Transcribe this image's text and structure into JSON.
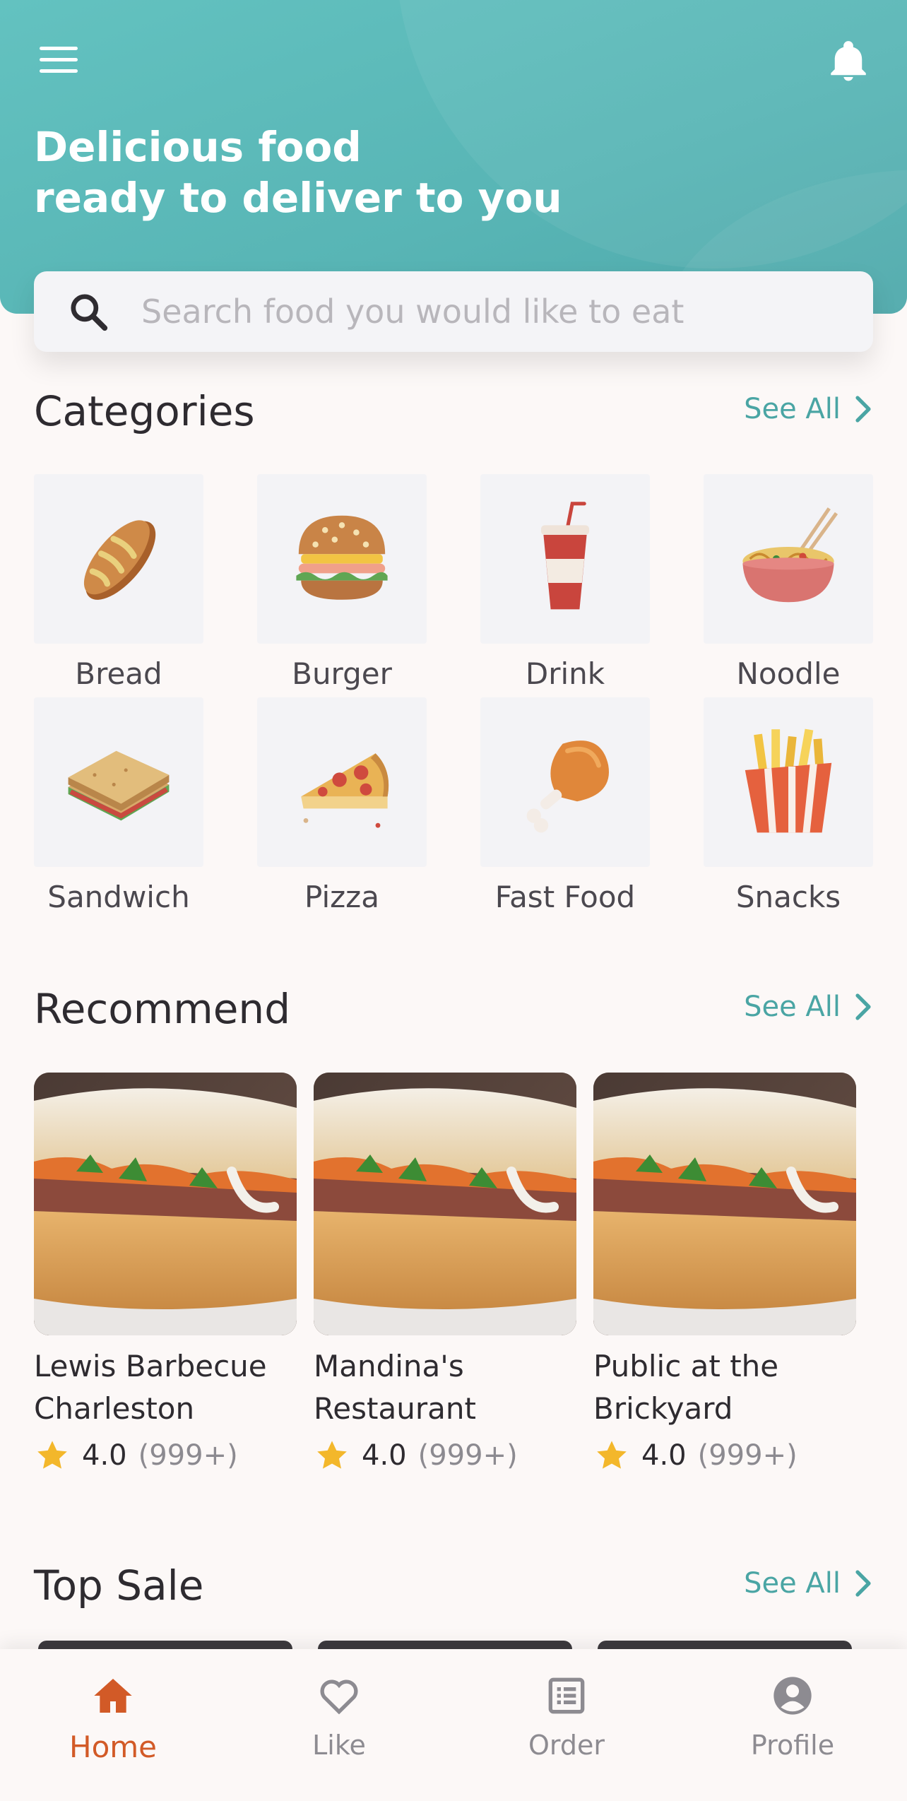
{
  "header": {
    "title_line1": "Delicious food",
    "title_line2": "ready to deliver to you",
    "menu_icon": "hamburger-menu-icon",
    "notification_icon": "bell-icon"
  },
  "search": {
    "placeholder": "Search food you would like to eat",
    "icon": "search-icon"
  },
  "categories": {
    "title": "Categories",
    "see_all": "See All",
    "items": [
      {
        "label": "Bread",
        "icon": "bread-icon"
      },
      {
        "label": "Burger",
        "icon": "burger-icon"
      },
      {
        "label": "Drink",
        "icon": "drink-icon"
      },
      {
        "label": "Noodle",
        "icon": "noodle-icon"
      },
      {
        "label": "Sandwich",
        "icon": "sandwich-icon"
      },
      {
        "label": "Pizza",
        "icon": "pizza-icon"
      },
      {
        "label": "Fast Food",
        "icon": "chicken-leg-icon"
      },
      {
        "label": "Snacks",
        "icon": "fries-icon"
      }
    ]
  },
  "recommend": {
    "title": "Recommend",
    "see_all": "See All",
    "items": [
      {
        "name_line1": "Lewis Barbecue",
        "name_line2": "Charleston",
        "rating": "4.0",
        "count": "(999+)"
      },
      {
        "name_line1": "Mandina's",
        "name_line2": "Restaurant",
        "rating": "4.0",
        "count": "(999+)"
      },
      {
        "name_line1": "Public at the",
        "name_line2": "Brickyard",
        "rating": "4.0",
        "count": "(999+)"
      }
    ]
  },
  "top_sale": {
    "title": "Top Sale",
    "see_all": "See All"
  },
  "bottom_nav": {
    "items": [
      {
        "label": "Home",
        "icon": "home-icon",
        "active": true
      },
      {
        "label": "Like",
        "icon": "heart-icon",
        "active": false
      },
      {
        "label": "Order",
        "icon": "order-list-icon",
        "active": false
      },
      {
        "label": "Profile",
        "icon": "profile-icon",
        "active": false
      }
    ]
  },
  "colors": {
    "header_teal": "#5bb9b8",
    "accent_teal": "#4aa5a4",
    "active_orange": "#d25a27",
    "star_yellow": "#f3b72b",
    "background": "#fcf8f7"
  }
}
